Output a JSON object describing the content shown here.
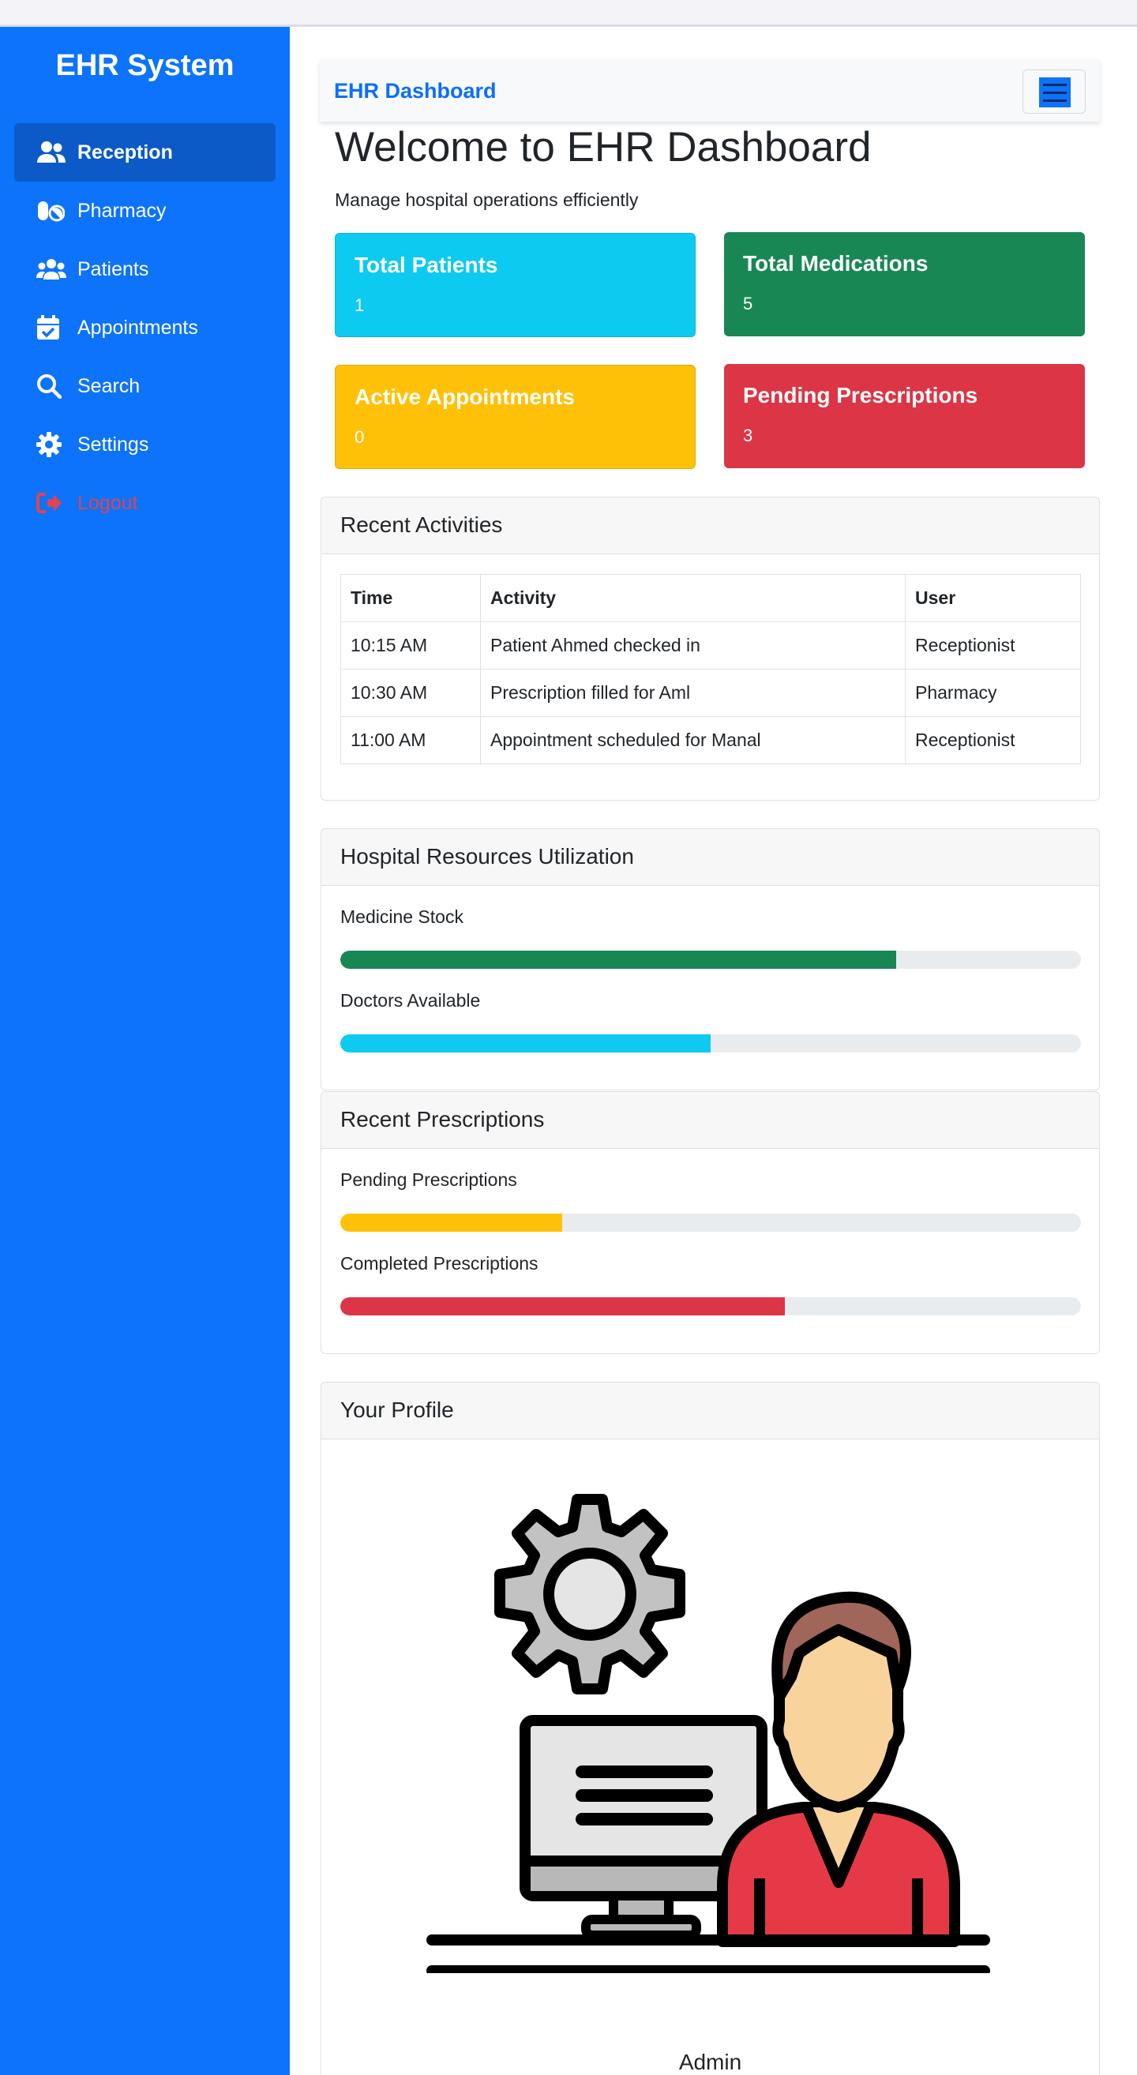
{
  "sidebar": {
    "brand": "EHR System",
    "items": [
      {
        "label": "Reception",
        "icon": "users-icon"
      },
      {
        "label": "Pharmacy",
        "icon": "pills-icon"
      },
      {
        "label": "Patients",
        "icon": "user-group-icon"
      },
      {
        "label": "Appointments",
        "icon": "calendar-check-icon"
      },
      {
        "label": "Search",
        "icon": "search-icon"
      },
      {
        "label": "Settings",
        "icon": "gear-icon"
      },
      {
        "label": "Logout",
        "icon": "sign-out-icon"
      }
    ]
  },
  "navbar": {
    "brand": "EHR Dashboard"
  },
  "header": {
    "title": "Welcome to EHR Dashboard",
    "subtitle": "Manage hospital operations efficiently"
  },
  "stats": [
    {
      "title": "Total Patients",
      "value": "1"
    },
    {
      "title": "Total Medications",
      "value": "5"
    },
    {
      "title": "Active Appointments",
      "value": "0"
    },
    {
      "title": "Pending Prescriptions",
      "value": "3"
    }
  ],
  "activities": {
    "title": "Recent Activities",
    "columns": [
      "Time",
      "Activity",
      "User"
    ],
    "rows": [
      [
        "10:15 AM",
        "Patient Ahmed checked in",
        "Receptionist"
      ],
      [
        "10:30 AM",
        "Prescription filled for Aml",
        "Pharmacy"
      ],
      [
        "11:00 AM",
        "Appointment scheduled for Manal",
        "Receptionist"
      ]
    ]
  },
  "resources": {
    "title": "Hospital Resources Utilization",
    "items": [
      {
        "label": "Medicine Stock",
        "percent": 75,
        "color": "#198754"
      },
      {
        "label": "Doctors Available",
        "percent": 50,
        "color": "#0dcaf0"
      }
    ]
  },
  "prescriptions": {
    "title": "Recent Prescriptions",
    "items": [
      {
        "label": "Pending Prescriptions",
        "percent": 30,
        "color": "#ffc107"
      },
      {
        "label": "Completed Prescriptions",
        "percent": 60,
        "color": "#dc3545"
      }
    ]
  },
  "profile": {
    "title": "Your Profile",
    "name": "Admin"
  },
  "colors": {
    "sidebar": "#0d73fa",
    "primary": "#0d6efd",
    "logout": "#e04352"
  }
}
